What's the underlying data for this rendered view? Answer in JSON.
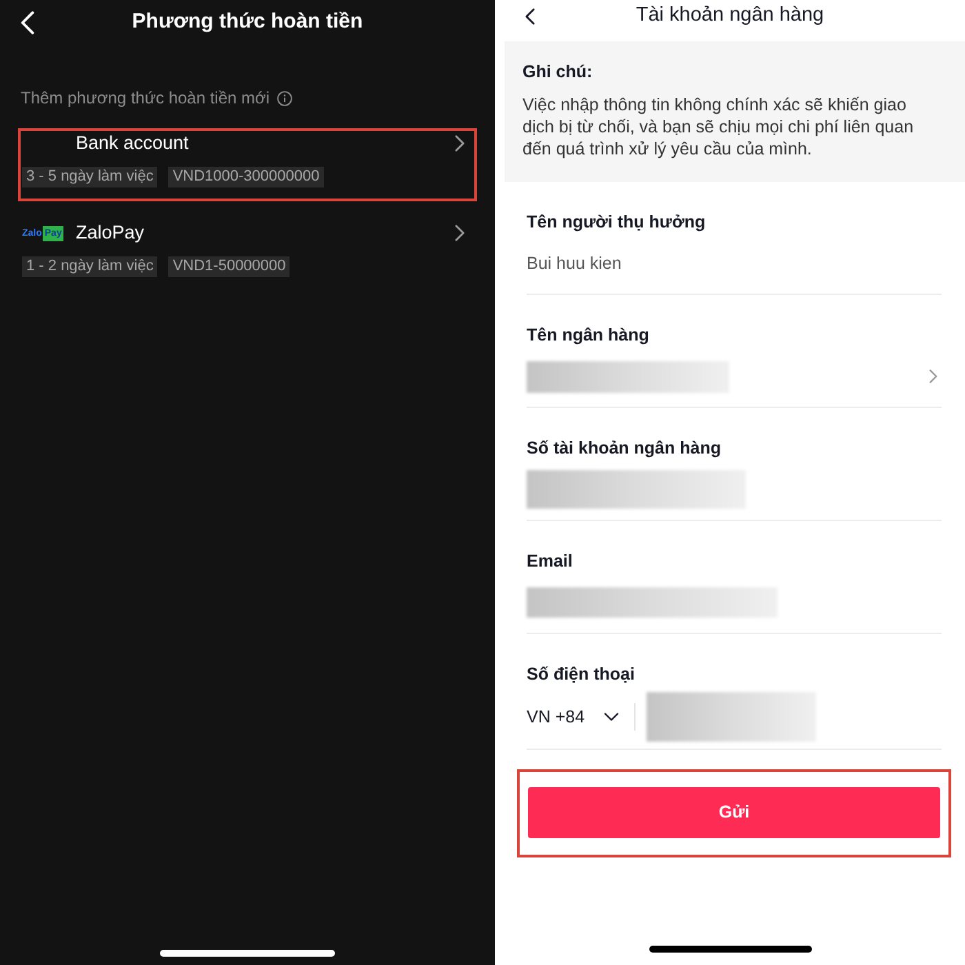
{
  "left_screen": {
    "title": "Phương thức hoàn tiền",
    "section_label": "Thêm phương thức hoàn tiền mới",
    "methods": [
      {
        "name": "Bank account",
        "kind": "bank",
        "highlighted": true,
        "tags": [
          "3 - 5 ngày làm việc",
          "VND1000-300000000"
        ]
      },
      {
        "name": "ZaloPay",
        "kind": "zalopay",
        "logo_text": [
          "Zalo",
          "Pay"
        ],
        "highlighted": false,
        "tags": [
          "1 - 2 ngày làm việc",
          "VND1-50000000"
        ]
      }
    ]
  },
  "right_screen": {
    "title": "Tài khoản ngân hàng",
    "note": {
      "heading": "Ghi chú:",
      "text": "Việc nhập thông tin không chính xác sẽ khiến giao dịch bị từ chối, và bạn sẽ chịu mọi chi phí liên quan đến quá trình xử lý yêu cầu của mình."
    },
    "fields": [
      {
        "label": "Tên người thụ hưởng",
        "kind": "text",
        "value": "Bui huu kien"
      },
      {
        "label": "Tên ngân hàng",
        "kind": "picker"
      },
      {
        "label": "Số tài khoản ngân hàng",
        "kind": "blurred"
      },
      {
        "label": "Email",
        "kind": "blurred"
      },
      {
        "label": "Số điện thoại",
        "kind": "phone",
        "country_code": "VN +84"
      }
    ],
    "submit": {
      "label": "Gửi",
      "highlighted": true
    }
  }
}
